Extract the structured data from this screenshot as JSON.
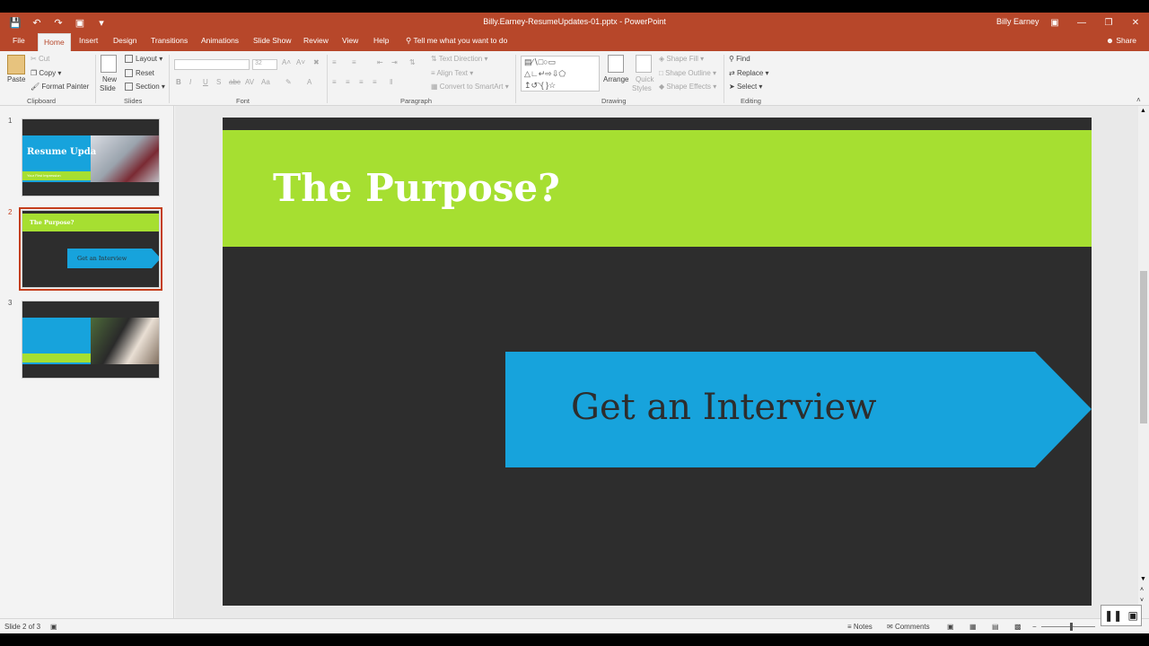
{
  "window": {
    "title": "Billy.Earney-ResumeUpdates-01.pptx - PowerPoint",
    "user": "Billy Earney"
  },
  "tabs": [
    "File",
    "Home",
    "Insert",
    "Design",
    "Transitions",
    "Animations",
    "Slide Show",
    "Review",
    "View",
    "Help"
  ],
  "tellme": "Tell me what you want to do",
  "share": "Share",
  "ribbon": {
    "clipboard": {
      "paste": "Paste",
      "cut": "Cut",
      "copy": "Copy",
      "format_painter": "Format Painter",
      "label": "Clipboard"
    },
    "slides": {
      "new_slide_1": "New",
      "new_slide_2": "Slide",
      "layout": "Layout",
      "reset": "Reset",
      "section": "Section",
      "label": "Slides"
    },
    "font": {
      "size": "32",
      "label": "Font"
    },
    "paragraph": {
      "text_direction": "Text Direction",
      "align_text": "Align Text",
      "convert_smartart": "Convert to SmartArt",
      "label": "Paragraph"
    },
    "drawing": {
      "arrange": "Arrange",
      "quick_styles_1": "Quick",
      "quick_styles_2": "Styles",
      "shape_fill": "Shape Fill",
      "shape_outline": "Shape Outline",
      "shape_effects": "Shape Effects",
      "label": "Drawing"
    },
    "editing": {
      "find": "Find",
      "replace": "Replace",
      "select": "Select",
      "label": "Editing"
    }
  },
  "thumbnails": [
    {
      "num": "1",
      "title": "Resume Upda",
      "subtitle": "Your First Impression"
    },
    {
      "num": "2",
      "title": "The Purpose?",
      "arrow_text": "Get an Interview"
    },
    {
      "num": "3"
    }
  ],
  "slide": {
    "title": "The Purpose?",
    "arrow_text": "Get an Interview"
  },
  "status": {
    "slide_of": "Slide 2 of 3",
    "notes": "Notes",
    "comments": "Comments"
  },
  "colors": {
    "accent": "#b7472a",
    "slide_bg": "#2d2d2d",
    "title_band": "#a6df31",
    "arrow": "#17a3dc"
  }
}
